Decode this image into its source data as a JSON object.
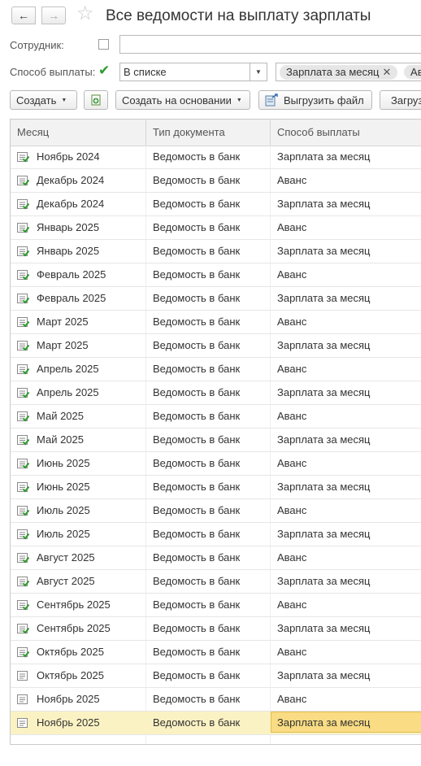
{
  "header": {
    "back_icon": "←",
    "forward_icon": "→",
    "star_icon": "☆",
    "title": "Все ведомости на выплату зарплаты"
  },
  "filters": {
    "employee_label": "Сотрудник:",
    "employee_value": "",
    "payment_label": "Способ выплаты:",
    "payment_checked": true,
    "payment_condition": "В списке",
    "tags": [
      "Зарплата за месяц",
      "Аванс"
    ]
  },
  "toolbar": {
    "create_label": "Создать",
    "create_basis_label": "Создать на основании",
    "export_file_label": "Выгрузить файл",
    "next_label": "Загрузить"
  },
  "table": {
    "columns": [
      "Месяц",
      "Тип документа",
      "Способ выплаты"
    ],
    "rows": [
      {
        "month": "Ноябрь 2024",
        "doc_type": "Ведомость в банк",
        "method": "Зарплата за месяц",
        "posted": true
      },
      {
        "month": "Декабрь 2024",
        "doc_type": "Ведомость в банк",
        "method": "Аванс",
        "posted": true
      },
      {
        "month": "Декабрь 2024",
        "doc_type": "Ведомость в банк",
        "method": "Зарплата за месяц",
        "posted": true
      },
      {
        "month": "Январь 2025",
        "doc_type": "Ведомость в банк",
        "method": "Аванс",
        "posted": true
      },
      {
        "month": "Январь 2025",
        "doc_type": "Ведомость в банк",
        "method": "Зарплата за месяц",
        "posted": true
      },
      {
        "month": "Февраль 2025",
        "doc_type": "Ведомость в банк",
        "method": "Аванс",
        "posted": true
      },
      {
        "month": "Февраль 2025",
        "doc_type": "Ведомость в банк",
        "method": "Зарплата за месяц",
        "posted": true
      },
      {
        "month": "Март 2025",
        "doc_type": "Ведомость в банк",
        "method": "Аванс",
        "posted": true
      },
      {
        "month": "Март 2025",
        "doc_type": "Ведомость в банк",
        "method": "Зарплата за месяц",
        "posted": true
      },
      {
        "month": "Апрель 2025",
        "doc_type": "Ведомость в банк",
        "method": "Аванс",
        "posted": true
      },
      {
        "month": "Апрель 2025",
        "doc_type": "Ведомость в банк",
        "method": "Зарплата за месяц",
        "posted": true
      },
      {
        "month": "Май 2025",
        "doc_type": "Ведомость в банк",
        "method": "Аванс",
        "posted": true
      },
      {
        "month": "Май 2025",
        "doc_type": "Ведомость в банк",
        "method": "Зарплата за месяц",
        "posted": true
      },
      {
        "month": "Июнь 2025",
        "doc_type": "Ведомость в банк",
        "method": "Аванс",
        "posted": true
      },
      {
        "month": "Июнь 2025",
        "doc_type": "Ведомость в банк",
        "method": "Зарплата за месяц",
        "posted": true
      },
      {
        "month": "Июль 2025",
        "doc_type": "Ведомость в банк",
        "method": "Аванс",
        "posted": true
      },
      {
        "month": "Июль 2025",
        "doc_type": "Ведомость в банк",
        "method": "Зарплата за месяц",
        "posted": true
      },
      {
        "month": "Август 2025",
        "doc_type": "Ведомость в банк",
        "method": "Аванс",
        "posted": true
      },
      {
        "month": "Август 2025",
        "doc_type": "Ведомость в банк",
        "method": "Зарплата за месяц",
        "posted": true
      },
      {
        "month": "Сентябрь 2025",
        "doc_type": "Ведомость в банк",
        "method": "Аванс",
        "posted": true
      },
      {
        "month": "Сентябрь 2025",
        "doc_type": "Ведомость в банк",
        "method": "Зарплата за месяц",
        "posted": true
      },
      {
        "month": "Октябрь 2025",
        "doc_type": "Ведомость в банк",
        "method": "Аванс",
        "posted": true
      },
      {
        "month": "Октябрь 2025",
        "doc_type": "Ведомость в банк",
        "method": "Зарплата за месяц",
        "posted": false
      },
      {
        "month": "Ноябрь 2025",
        "doc_type": "Ведомость в банк",
        "method": "Аванс",
        "posted": false
      },
      {
        "month": "Ноябрь 2025",
        "doc_type": "Ведомость в банк",
        "method": "Зарплата за месяц",
        "posted": false,
        "selected": true
      }
    ]
  },
  "colors": {
    "selected_row": "#fbf2c4",
    "selected_cell": "#f9dc83",
    "check_green": "#2e9a2e"
  }
}
